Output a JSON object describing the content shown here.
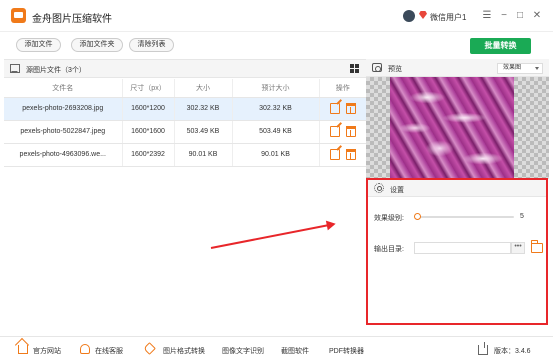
{
  "app": {
    "title": "金舟图片压缩软件",
    "user": "微信用户1"
  },
  "window": {
    "menu": "☰",
    "minimize": "−",
    "maximize": "□",
    "close": "✕"
  },
  "toolbar": {
    "add_file": "添加文件",
    "add_folder": "添加文件夹",
    "clear_list": "清除列表",
    "batch_convert": "批量转换"
  },
  "file_panel": {
    "title": "源图片文件（3个）",
    "columns": {
      "name": "文件名",
      "size_px": "尺寸（px）",
      "size": "大小",
      "est_size": "预计大小",
      "ops": "操作"
    },
    "rows": [
      {
        "name": "pexels-photo-2693208.jpg",
        "dims": "1600*1200",
        "size": "302.32 KB",
        "est": "302.32 KB",
        "selected": true
      },
      {
        "name": "pexels-photo-5022847.jpeg",
        "dims": "1600*1600",
        "size": "503.49 KB",
        "est": "503.49 KB",
        "selected": false
      },
      {
        "name": "pexels-photo-4963096.we...",
        "dims": "1600*2392",
        "size": "90.01 KB",
        "est": "90.01 KB",
        "selected": false
      }
    ]
  },
  "preview": {
    "title": "预览",
    "mode": "效果图"
  },
  "settings": {
    "title": "设置",
    "quality_label": "效果级别:",
    "quality_value": "5",
    "output_label": "输出目录:",
    "output_path": "",
    "browse": "•••"
  },
  "footer": {
    "website": "官方网站",
    "service": "在线客服",
    "format": "图片格式转换",
    "ocr": "图像文字识别",
    "screenshot": "截图软件",
    "pdf": "PDF转换器",
    "version": "版本：3.4.6"
  },
  "colors": {
    "accent": "#f07a1a",
    "primary": "#1aaa55",
    "highlight": "#e8262a"
  }
}
